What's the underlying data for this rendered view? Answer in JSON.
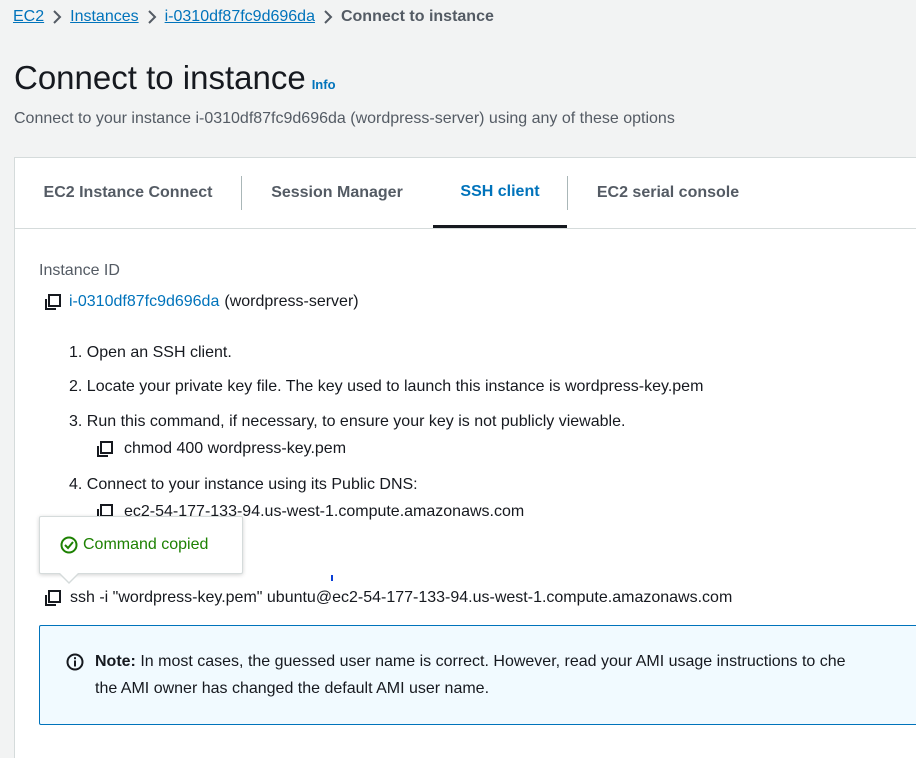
{
  "breadcrumb": {
    "items": [
      {
        "label": "EC2"
      },
      {
        "label": "Instances"
      },
      {
        "label": "i-0310df87fc9d696da"
      }
    ],
    "current": "Connect to instance"
  },
  "header": {
    "title": "Connect to instance",
    "info_label": "Info",
    "subtitle": "Connect to your instance i-0310df87fc9d696da (wordpress-server) using any of these options"
  },
  "tabs": [
    {
      "label": "EC2 Instance Connect"
    },
    {
      "label": "Session Manager"
    },
    {
      "label": "SSH client",
      "active": true
    },
    {
      "label": "EC2 serial console"
    }
  ],
  "instance": {
    "label": "Instance ID",
    "id": "i-0310df87fc9d696da",
    "name": "(wordpress-server)"
  },
  "steps": [
    {
      "text": "1. Open an SSH client."
    },
    {
      "text": "2. Locate your private key file. The key used to launch this instance is wordpress-key.pem"
    },
    {
      "text": "3. Run this command, if necessary, to ensure your key is not publicly viewable."
    },
    {
      "text": "4. Connect to your instance using its Public DNS:"
    }
  ],
  "chmod_command": "chmod 400 wordpress-key.pem",
  "public_dns": "ec2-54-177-133-94.us-west-1.compute.amazonaws.com",
  "tooltip": {
    "text": "Command copied"
  },
  "ssh_command": "ssh -i \"wordpress-key.pem\" ubuntu@ec2-54-177-133-94.us-west-1.compute.amazonaws.com",
  "note": {
    "label": "Note:",
    "text": "In most cases, the guessed user name is correct. However, read your AMI usage instructions to che",
    "text_line2": "the AMI owner has changed the default AMI user name."
  },
  "colors": {
    "link": "#0073bb",
    "success": "#1d8102",
    "note_background": "#f1faff"
  }
}
